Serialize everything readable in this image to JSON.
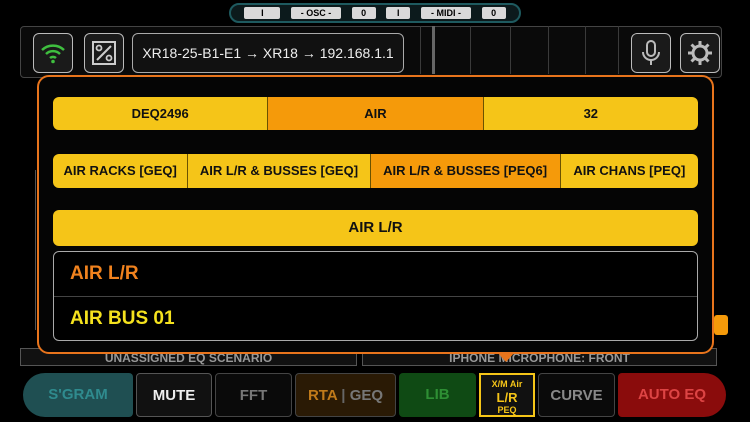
{
  "status": {
    "items": [
      "I",
      "- OSC -",
      "0",
      "I",
      "- MIDI -",
      "0"
    ]
  },
  "header": {
    "route": "XR18-25-B1-E1 → XR18 → 192.168.1.1",
    "wifi_icon": "wifi-icon",
    "percent_icon": "percent-icon",
    "mic_icon": "microphone-icon",
    "gear_icon": "gear-icon"
  },
  "background": {
    "scenario_left": "UNASSIGNED EQ SCENARIO",
    "scenario_right": "IPHONE MICROPHONE: FRONT"
  },
  "dialog": {
    "row1": [
      {
        "label": "DEQ2496",
        "selected": false
      },
      {
        "label": "AIR",
        "selected": true
      },
      {
        "label": "32",
        "selected": false
      }
    ],
    "row2": [
      {
        "label": "AIR RACKS [GEQ]",
        "selected": false
      },
      {
        "label": "AIR L/R & BUSSES [GEQ]",
        "selected": false
      },
      {
        "label": "AIR L/R & BUSSES [PEQ6]",
        "selected": true
      },
      {
        "label": "AIR CHANS [PEQ]",
        "selected": false
      }
    ],
    "list_header": "AIR L/R",
    "list": [
      {
        "label": "AIR L/R",
        "color": "#f0821e"
      },
      {
        "label": "AIR BUS 01",
        "color": "#f5e21e"
      }
    ]
  },
  "toolbar": {
    "sgram": "S'GRAM",
    "mute": "MUTE",
    "fft": "FFT",
    "rta": "RTA",
    "geq": "GEQ",
    "lib": "LIB",
    "xm_title": "X/M Air",
    "xm_lr": "L/R",
    "xm_peq": "PEQ",
    "curve": "CURVE",
    "auto_eq": "AUTO EQ"
  },
  "colors": {
    "accent": "#e8741c",
    "segment": "#f5c518",
    "segment_selected": "#f59a0a"
  }
}
